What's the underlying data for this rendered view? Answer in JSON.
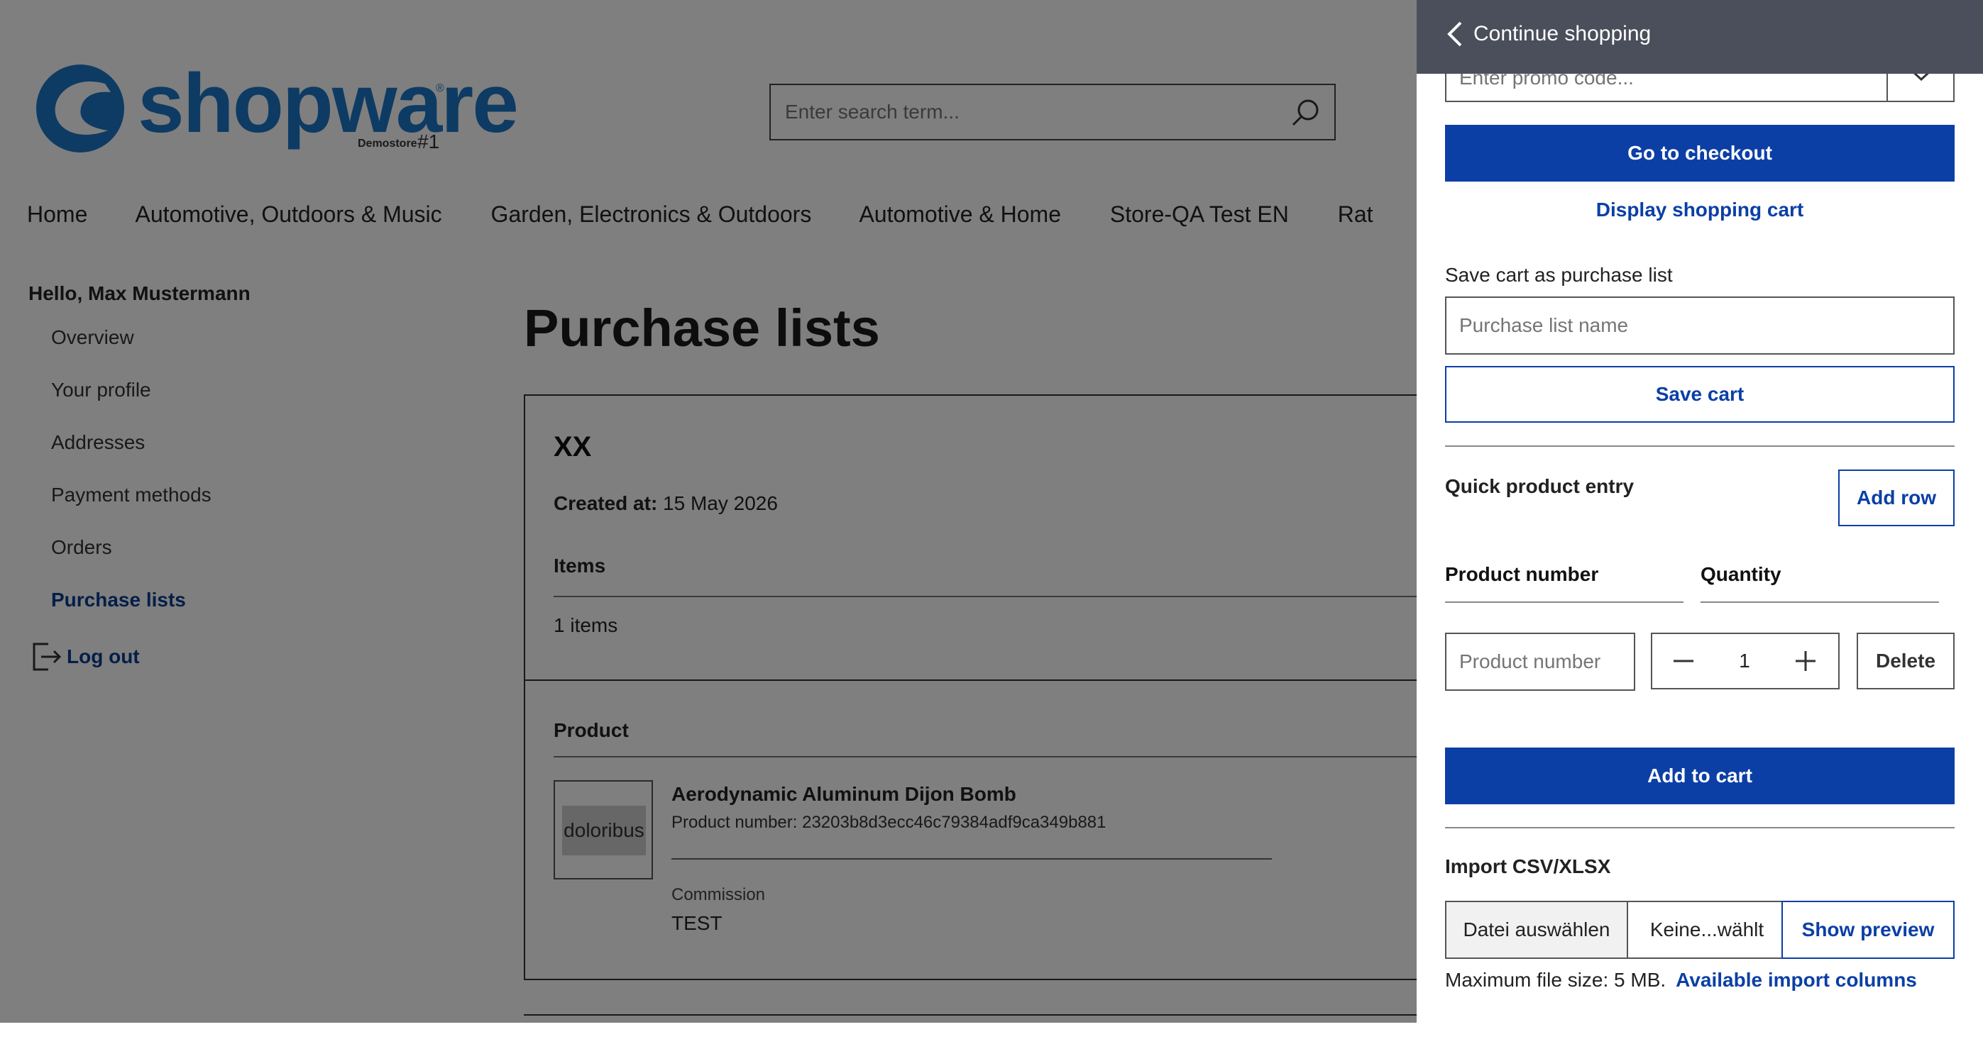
{
  "header": {
    "logo_text": "shopware",
    "logo_reg": "®",
    "logo_demo": "Demostore",
    "logo_num": "#1",
    "search_placeholder": "Enter search term..."
  },
  "nav": {
    "items": [
      "Home",
      "Automotive, Outdoors & Music",
      "Garden, Electronics & Outdoors",
      "Automotive & Home",
      "Store-QA Test EN",
      "Rat"
    ]
  },
  "sidebar": {
    "greeting": "Hello, Max Mustermann",
    "items": [
      "Overview",
      "Your profile",
      "Addresses",
      "Payment methods",
      "Orders",
      "Purchase lists"
    ],
    "logout": "Log out"
  },
  "main": {
    "title": "Purchase lists",
    "list": {
      "name": "XX",
      "created_label": "Created at:",
      "created_value": "15 May 2026",
      "items_heading": "Items",
      "items_count": "1 items",
      "product_heading": "Product",
      "product": {
        "thumb_text": "doloribus",
        "name": "Aerodynamic Aluminum Dijon Bomb",
        "number": "Product number: 23203b8d3ecc46c79384adf9ca349b881",
        "commission_label": "Commission",
        "commission_value": "TEST"
      }
    }
  },
  "panel": {
    "continue_shopping": "Continue shopping",
    "promo_placeholder": "Enter promo code...",
    "checkout": "Go to checkout",
    "display_cart": "Display shopping cart",
    "save_label": "Save cart as purchase list",
    "list_name_placeholder": "Purchase list name",
    "save_cart": "Save cart",
    "quick_entry": "Quick product entry",
    "add_row": "Add row",
    "col_product_number": "Product number",
    "col_quantity": "Quantity",
    "product_number_placeholder": "Product number",
    "quantity": "1",
    "delete": "Delete",
    "add_to_cart": "Add to cart",
    "import_heading": "Import CSV/XLSX",
    "file_choose": "Datei auswählen",
    "file_none": "Keine...wählt",
    "show_preview": "Show preview",
    "max_size": "Maximum file size: 5 MB.",
    "import_columns": "Available import columns"
  },
  "colors": {
    "brand": "#1a76c6",
    "primary": "#0b3fa6",
    "header_dark": "#4b4f5c"
  }
}
